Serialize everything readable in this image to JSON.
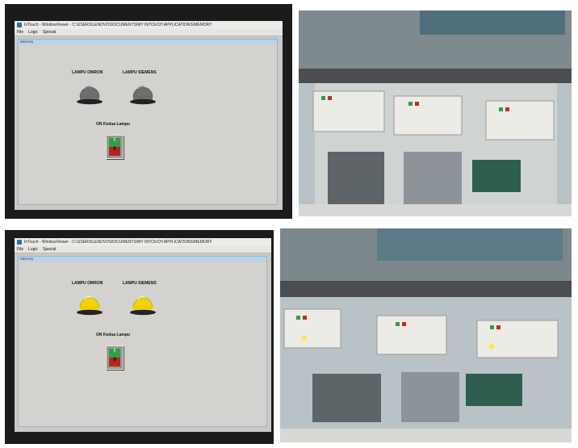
{
  "window": {
    "title": "InTouch - WindowViewer - C:\\USERS\\LENOVO\\DOCUMENTS\\MY INTOUCH APPLICATIONS\\MEMORY",
    "menu": [
      "File",
      "Logic",
      "Special"
    ],
    "doc_tab": "Memory"
  },
  "lamps": {
    "omron_label": "LAMPU OMRON",
    "siemens_label": "LAMPU SIEMENS"
  },
  "switch": {
    "label": "ON Kedua Lampu",
    "on_text": "I",
    "off_text": "0"
  },
  "states": [
    {
      "name": "off",
      "lamp_color": "#6f6f6f"
    },
    {
      "name": "on",
      "lamp_color": "#f3d300"
    }
  ],
  "photos": [
    {
      "state": "off",
      "caption": ""
    },
    {
      "state": "on",
      "caption": ""
    }
  ],
  "colors": {
    "lamp_off": "#6f6f6f",
    "lamp_on": "#f3d300",
    "switch_on": "#2fa04a",
    "switch_off": "#b3261e",
    "desk": "#c9c9c6"
  }
}
